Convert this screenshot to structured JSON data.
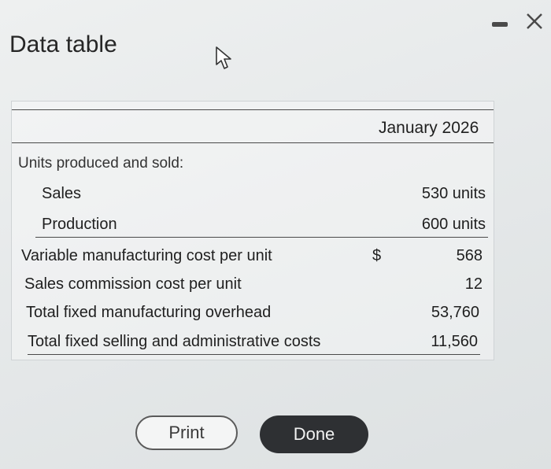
{
  "window": {
    "title": "Data table"
  },
  "table": {
    "column_header": "January 2026",
    "section_label": "Units produced and sold:",
    "unit_rows": [
      {
        "label": "Sales",
        "value": "530 units"
      },
      {
        "label": "Production",
        "value": "600 units"
      }
    ],
    "currency_symbol": "$",
    "cost_rows": [
      {
        "label": "Variable manufacturing cost per unit",
        "value": "568"
      },
      {
        "label": "Sales commission cost per unit",
        "value": "12"
      },
      {
        "label": "Total fixed manufacturing overhead",
        "value": "53,760"
      },
      {
        "label": "Total fixed selling and administrative costs",
        "value": "11,560"
      }
    ]
  },
  "buttons": {
    "print_label": "Print",
    "done_label": "Done"
  }
}
